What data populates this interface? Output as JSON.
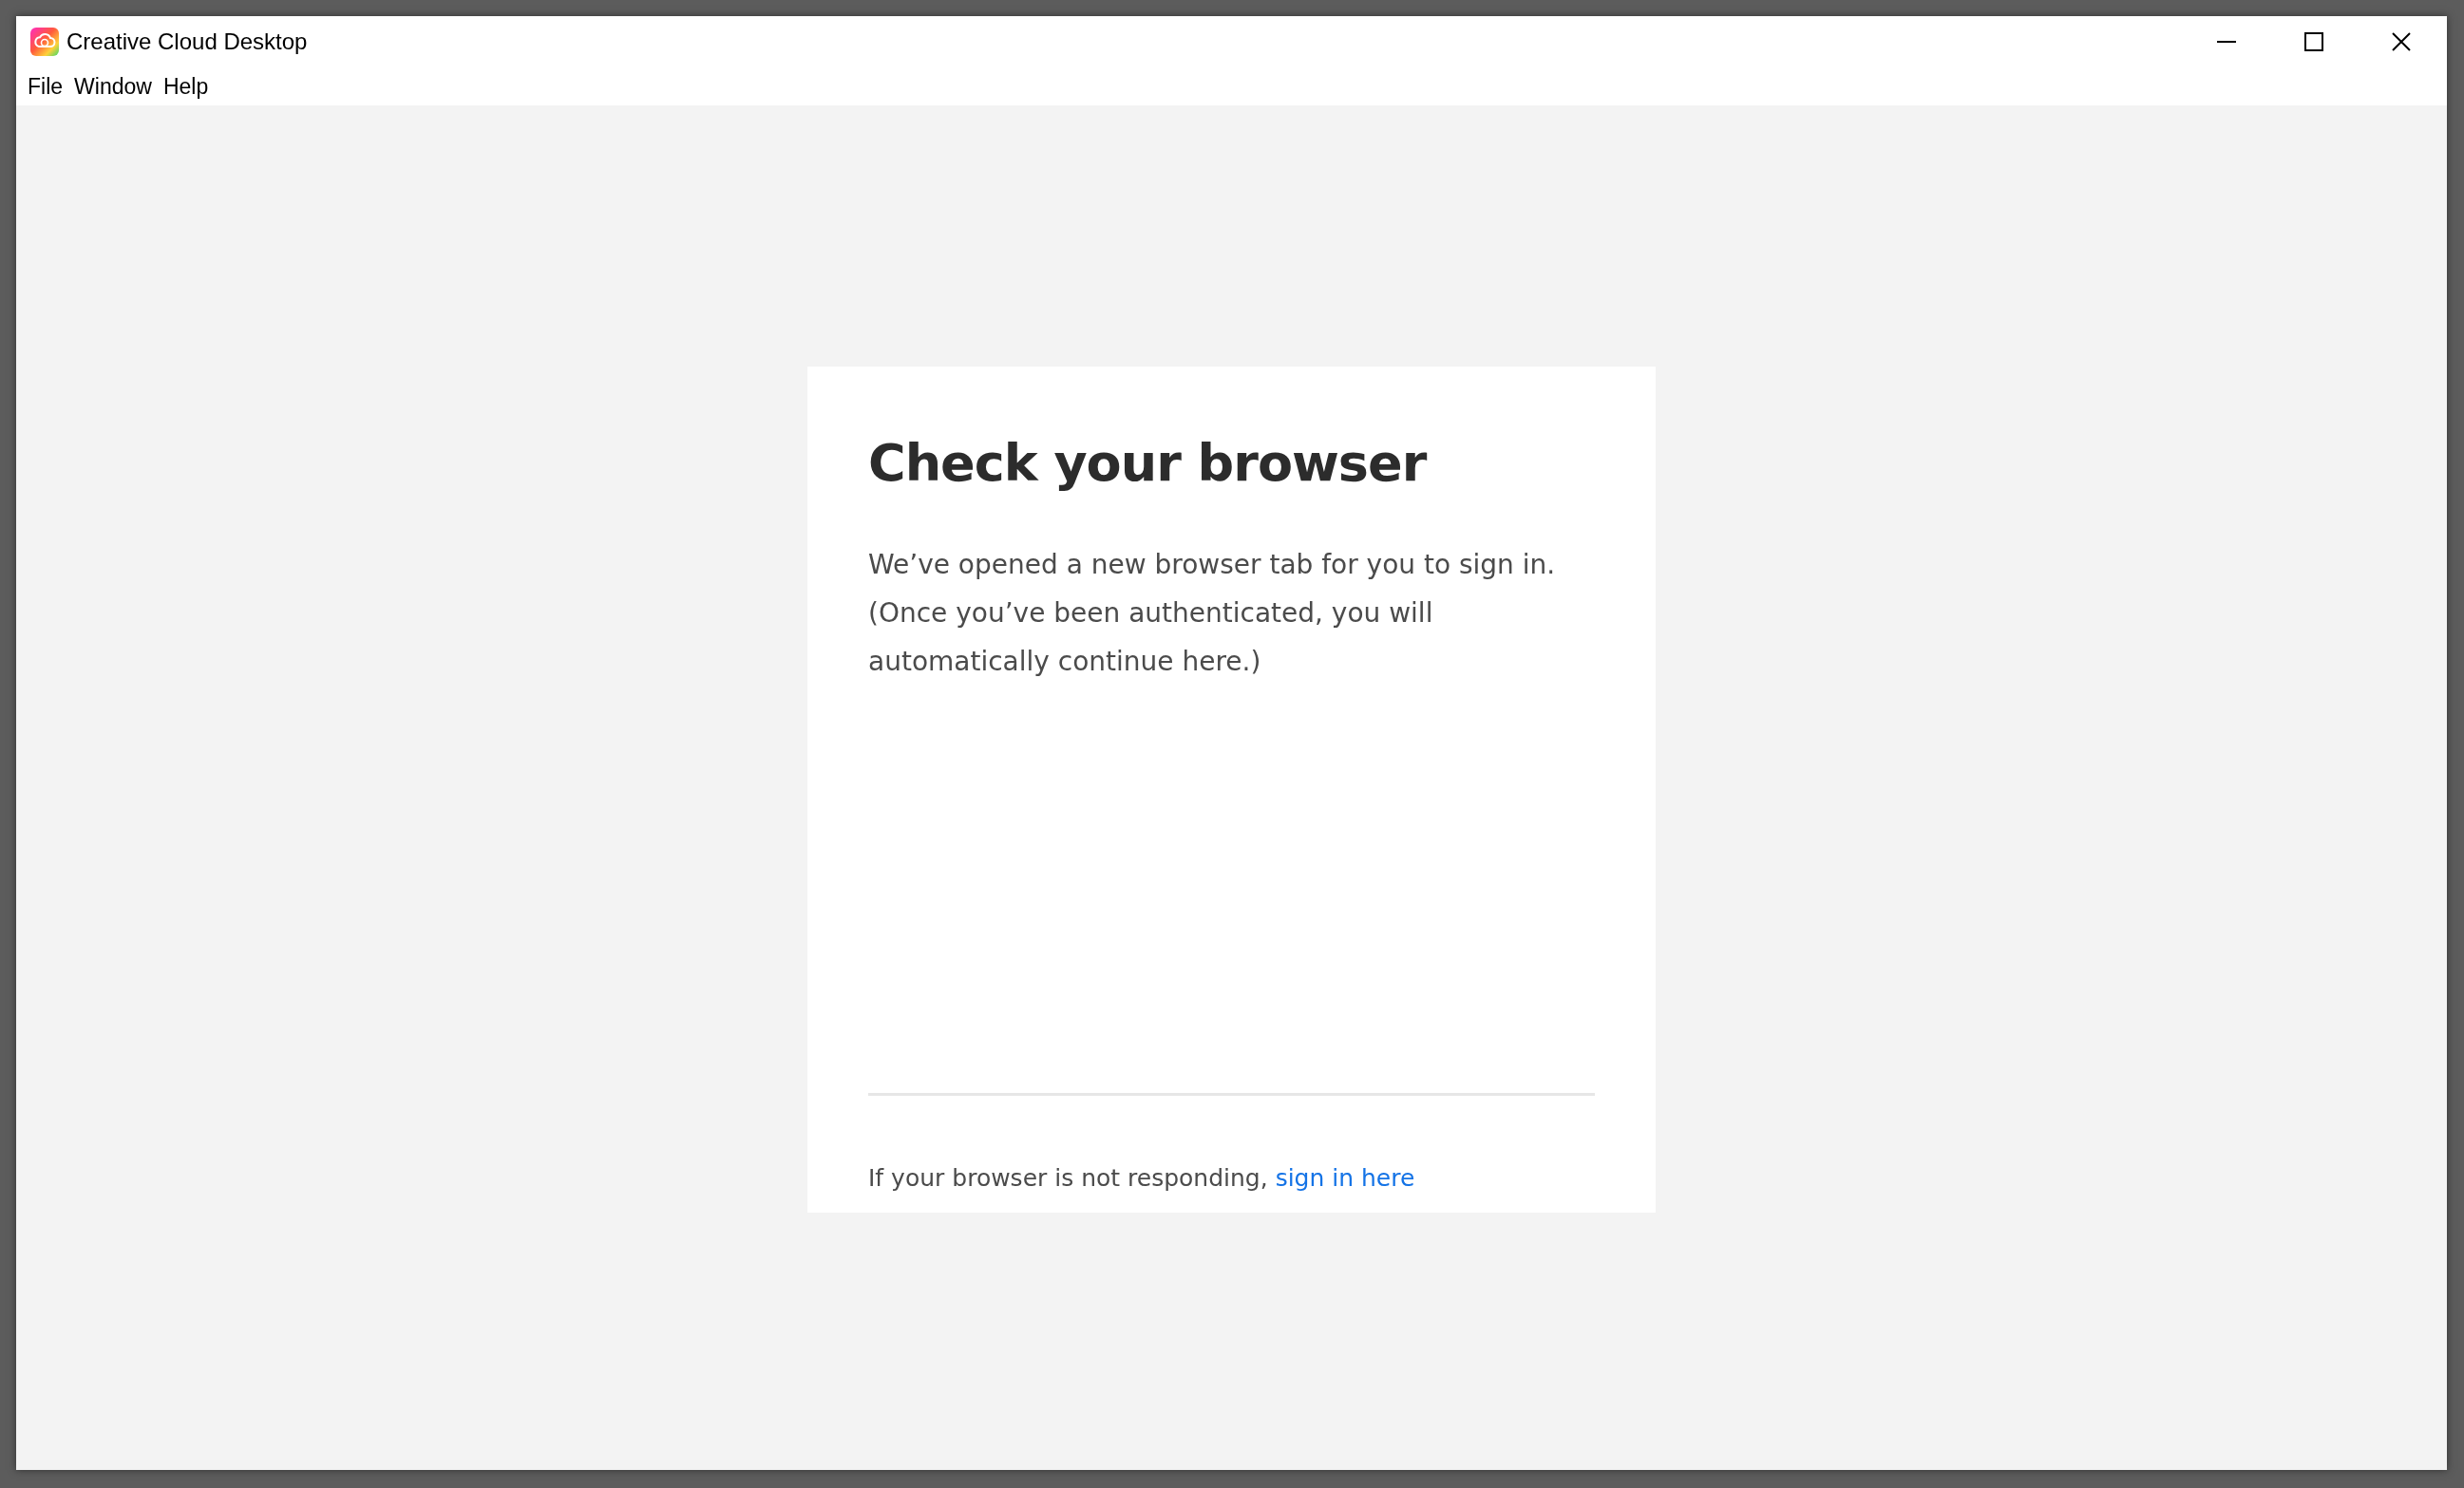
{
  "window": {
    "title": "Creative Cloud Desktop"
  },
  "menu": [
    "File",
    "Window",
    "Help"
  ],
  "card": {
    "title": "Check your browser",
    "message": "We’ve opened a new browser tab for you to sign in. (Once you’ve been authenticated, you will automatically continue here.)",
    "footer_text": "If your browser is not responding,",
    "footer_link": "sign in here"
  }
}
